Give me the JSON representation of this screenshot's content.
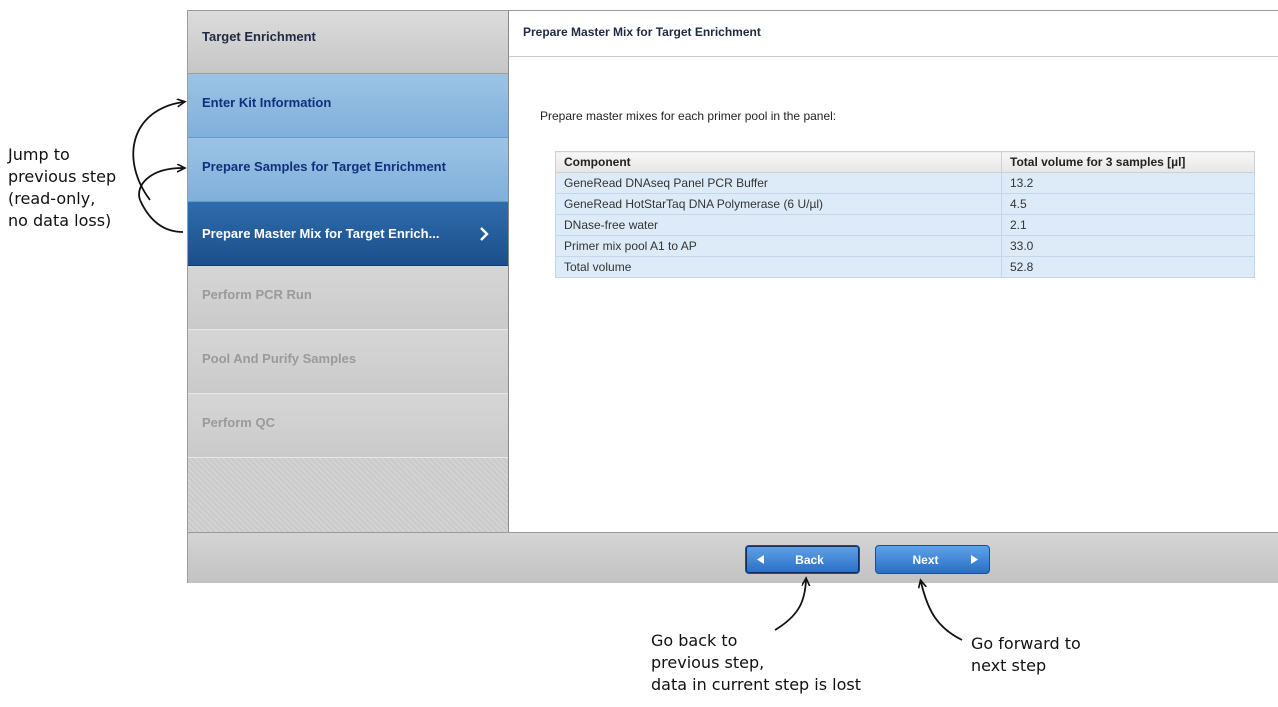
{
  "sidebar": {
    "header": "Target Enrichment",
    "steps": [
      {
        "label": "Enter Kit Information",
        "state": "done"
      },
      {
        "label": "Prepare Samples for Target Enrichment",
        "state": "done"
      },
      {
        "label": "Prepare Master Mix for Target Enrich...",
        "state": "active"
      },
      {
        "label": "Perform PCR Run",
        "state": "future"
      },
      {
        "label": "Pool And Purify Samples",
        "state": "future"
      },
      {
        "label": "Perform QC",
        "state": "future"
      }
    ]
  },
  "content": {
    "title": "Prepare Master Mix for Target Enrichment",
    "intro": "Prepare master mixes for each primer pool in the panel:",
    "table": {
      "headers": [
        "Component",
        "Total volume for 3 samples [µl]"
      ],
      "rows": [
        [
          "GeneRead DNAseq Panel PCR Buffer",
          "13.2"
        ],
        [
          "GeneRead HotStarTaq DNA Polymerase (6 U/µl)",
          "4.5"
        ],
        [
          "DNase-free water",
          "2.1"
        ],
        [
          "Primer mix pool A1 to AP",
          "33.0"
        ],
        [
          "Total volume",
          "52.8"
        ]
      ]
    }
  },
  "footer": {
    "back_label": "Back",
    "next_label": "Next"
  },
  "annotations": {
    "jump_line1": "Jump to",
    "jump_line2": "previous step",
    "jump_line3": "(read-only,",
    "jump_line4": "no data loss)",
    "back_line1": "Go back to",
    "back_line2": "previous step,",
    "back_line3": "data in current step is lost",
    "next_line1": "Go forward to",
    "next_line2": "next step"
  },
  "colors": {
    "active_step": "#1b4f8a",
    "done_step": "#8cb9e0",
    "button": "#2a6ec5",
    "table_row": "#ddebf8"
  }
}
